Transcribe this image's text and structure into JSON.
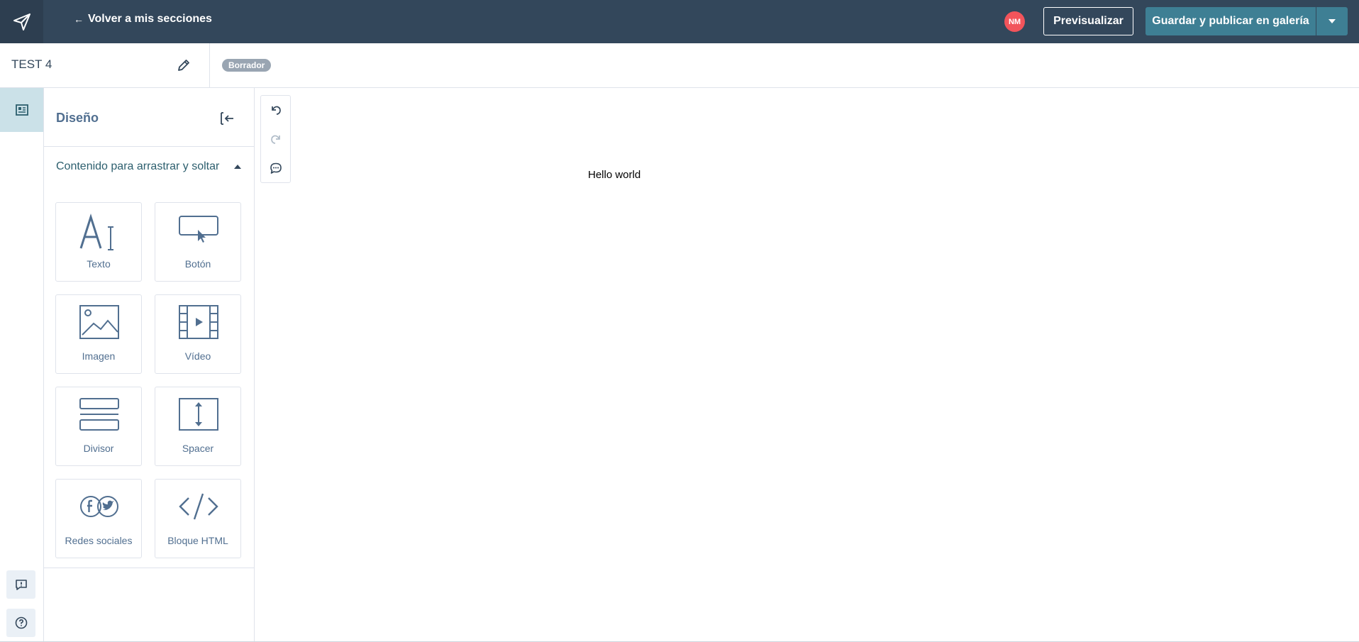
{
  "header": {
    "back_label": "Volver a mis secciones",
    "back_arrow": "←",
    "avatar_initials": "NM",
    "preview_label": "Previsualizar",
    "publish_label": "Guardar y publicar en galería"
  },
  "subheader": {
    "page_name": "TEST 4",
    "status": "Borrador"
  },
  "panel": {
    "title": "Diseño",
    "section_label": "Contenido para arrastrar y soltar",
    "tiles": [
      {
        "label": "Texto",
        "icon": "text-icon"
      },
      {
        "label": "Botón",
        "icon": "button-icon"
      },
      {
        "label": "Imagen",
        "icon": "image-icon"
      },
      {
        "label": "Vídeo",
        "icon": "video-icon"
      },
      {
        "label": "Divisor",
        "icon": "divider-icon"
      },
      {
        "label": "Spacer",
        "icon": "spacer-icon"
      },
      {
        "label": "Redes sociales",
        "icon": "social-icon"
      },
      {
        "label": "Bloque HTML",
        "icon": "code-icon"
      }
    ]
  },
  "canvas": {
    "content_text": "Hello world"
  },
  "colors": {
    "topbar": "#33475b",
    "accent": "#3e7f94",
    "avatar": "#f2545b",
    "badge": "#99a5b2"
  }
}
